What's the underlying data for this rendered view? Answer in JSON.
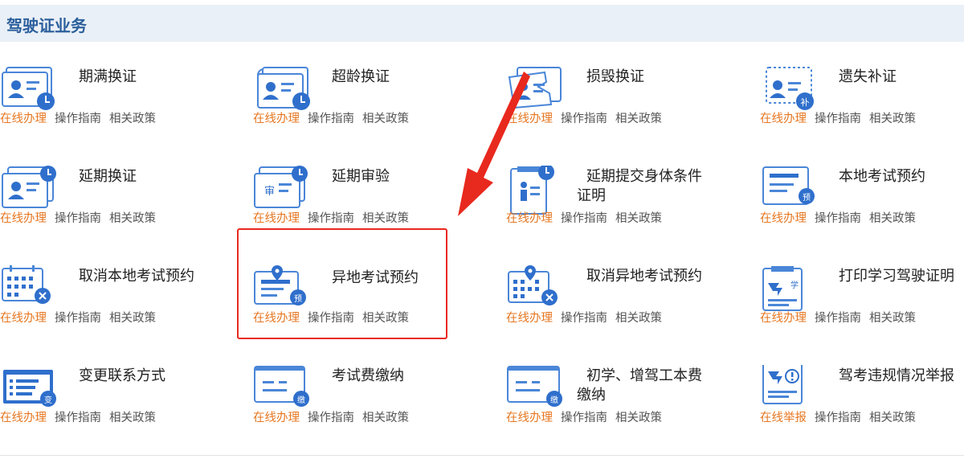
{
  "header": {
    "title": "驾驶证业务"
  },
  "colors": {
    "accent_blue": "#3a78d0",
    "link_orange": "#e67722",
    "highlight_red": "#e8291e"
  },
  "items": [
    {
      "name": "期满换证",
      "icon": "license-clock-icon",
      "links": [
        "在线办理",
        "操作指南",
        "相关政策"
      ]
    },
    {
      "name": "超龄换证",
      "icon": "license-refresh-clock-icon",
      "links": [
        "在线办理",
        "操作指南",
        "相关政策"
      ]
    },
    {
      "name": "损毁换证",
      "icon": "damaged-license-icon",
      "links": [
        "在线办理",
        "操作指南",
        "相关政策"
      ]
    },
    {
      "name": "遗失补证",
      "icon": "lost-license-icon",
      "links": [
        "在线办理",
        "操作指南",
        "相关政策"
      ]
    },
    {
      "name": "延期换证",
      "icon": "license-delay-icon",
      "links": [
        "在线办理",
        "操作指南",
        "相关政策"
      ]
    },
    {
      "name": "延期审验",
      "icon": "review-delay-icon",
      "links": [
        "在线办理",
        "操作指南",
        "相关政策"
      ]
    },
    {
      "name_line1": "延期提交身体条件",
      "name_line2": "证明",
      "icon": "health-certificate-icon",
      "links": [
        "在线办理",
        "操作指南",
        "相关政策"
      ]
    },
    {
      "name": "本地考试预约",
      "icon": "local-exam-booking-icon",
      "links": [
        "在线办理",
        "操作指南",
        "相关政策"
      ]
    },
    {
      "name": "取消本地考试预约",
      "icon": "calendar-cancel-icon",
      "links": [
        "在线办理",
        "操作指南",
        "相关政策"
      ]
    },
    {
      "name": "异地考试预约",
      "icon": "remote-exam-booking-icon",
      "links": [
        "在线办理",
        "操作指南",
        "相关政策"
      ]
    },
    {
      "name": "取消异地考试预约",
      "icon": "calendar-location-cancel-icon",
      "links": [
        "在线办理",
        "操作指南",
        "相关政策"
      ]
    },
    {
      "name": "打印学习驾驶证明",
      "icon": "learner-certificate-icon",
      "links": [
        "在线办理",
        "操作指南",
        "相关政策"
      ]
    },
    {
      "name": "变更联系方式",
      "icon": "contact-change-icon",
      "links": [
        "在线办理",
        "操作指南",
        "相关政策"
      ]
    },
    {
      "name": "考试费缴纳",
      "icon": "exam-fee-icon",
      "links": [
        "在线办理",
        "操作指南",
        "相关政策"
      ]
    },
    {
      "name_line1": "初学、增驾工本费",
      "name_line2": "缴纳",
      "icon": "fee-payment-icon",
      "links": [
        "在线办理",
        "操作指南",
        "相关政策"
      ]
    },
    {
      "name": "驾考违规情况举报",
      "icon": "violation-report-icon",
      "links": [
        "在线举报",
        "操作指南",
        "相关政策"
      ]
    }
  ]
}
